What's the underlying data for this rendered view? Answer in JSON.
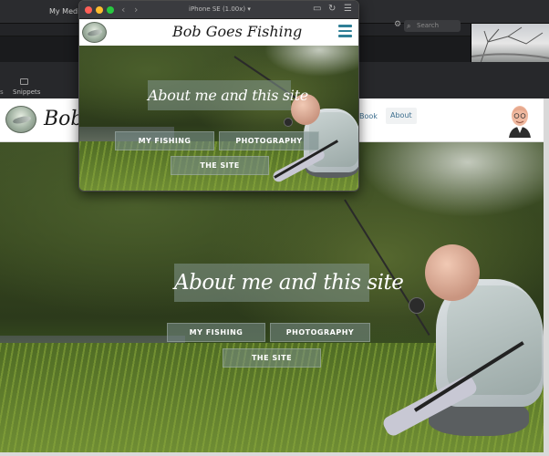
{
  "background_app": {
    "title": "My Media",
    "search_placeholder": "Search",
    "snippets_label": "Snippets",
    "left_fragment": "s"
  },
  "simulator": {
    "device_label": "iPhone SE (1.00x)"
  },
  "site": {
    "title": "Bob Goes Fishing",
    "hero_title": "About me and this site",
    "buttons": {
      "fishing": "MY FISHING",
      "photography": "PHOTOGRAPHY",
      "site": "THE SITE"
    },
    "nav": {
      "book": "Book",
      "about": "About"
    }
  },
  "icons": {
    "menu": "hamburger-menu-icon",
    "search": "search-icon",
    "gear": "gear-icon",
    "back": "chevron-left-icon",
    "forward": "chevron-right-icon",
    "screenshot": "screenshot-icon",
    "rotate": "rotate-icon",
    "menu_sim": "menu-icon"
  },
  "colors": {
    "close": "#ff5f57",
    "minimize": "#febc2e",
    "zoom": "#28c840",
    "accent": "#2f7f96"
  }
}
